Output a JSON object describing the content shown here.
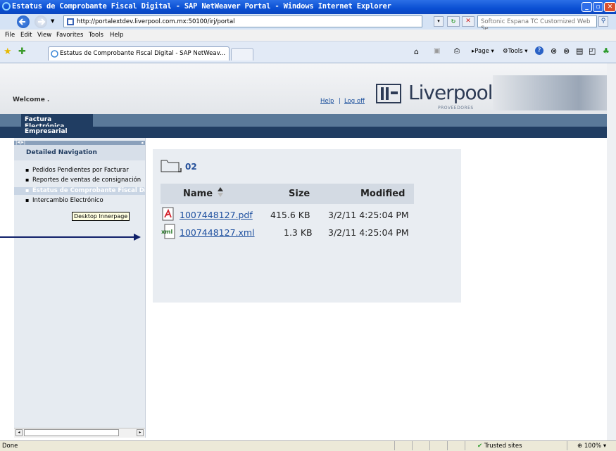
{
  "window": {
    "title": "Estatus de Comprobante Fiscal Digital - SAP NetWeaver Portal - Windows Internet Explorer"
  },
  "address_bar": {
    "url": "http://portalextdev.liverpool.com.mx:50100/irj/portal",
    "search_placeholder": "Softonic Espana TC Customized Web Se"
  },
  "menu": [
    "File",
    "Edit",
    "View",
    "Favorites",
    "Tools",
    "Help"
  ],
  "browser_tab": {
    "label": "Estatus de Comprobante Fiscal Digital - SAP NetWeav..."
  },
  "command_bar": {
    "page_label": "Page",
    "tools_label": "Tools"
  },
  "portal_header": {
    "welcome": "Welcome .",
    "help": "Help",
    "separator": "|",
    "logoff": "Log off",
    "logo_text": "Liverpool",
    "logo_sub": "PROVEEDORES"
  },
  "top_nav": {
    "active_tab": "Factura Electrónica",
    "sub_tab": "Empresarial"
  },
  "left_nav": {
    "header": "Detailed Navigation",
    "items": [
      {
        "label": "Pedidos Pendientes por Facturar"
      },
      {
        "label": "Reportes de ventas de consignación"
      },
      {
        "label": "Estatus de Comprobante Fiscal Dig"
      },
      {
        "label": "Intercambio Electrónico"
      }
    ],
    "tooltip": "Desktop Innerpage"
  },
  "content": {
    "folder_name": "02",
    "columns": {
      "name": "Name",
      "size": "Size",
      "modified": "Modified"
    },
    "files": [
      {
        "name": "1007448127.pdf",
        "size": "415.6 KB",
        "modified": "3/2/11 4:25:04 PM",
        "icon": "pdf-icon"
      },
      {
        "name": "1007448127.xml",
        "size": "1.3 KB",
        "modified": "3/2/11 4:25:04 PM",
        "icon": "xml-icon"
      }
    ]
  },
  "status_bar": {
    "status": "Done",
    "zone": "Trusted sites",
    "zoom": "100%"
  }
}
